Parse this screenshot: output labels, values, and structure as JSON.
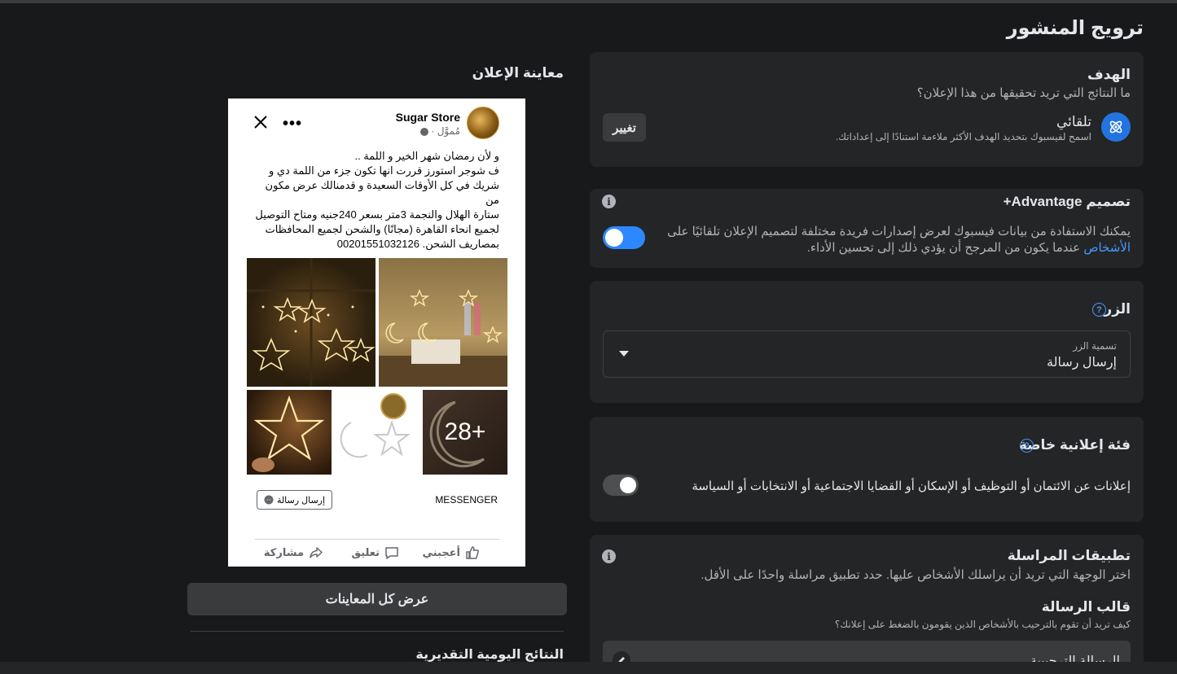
{
  "page": {
    "title": "ترويج المنشور"
  },
  "goal": {
    "heading": "الهدف",
    "question": "ما النتائج التي تريد تحقيقها من هذا الإعلان؟",
    "option_name": "تلقائي",
    "option_desc": "اسمح لفيسبوك بتحديد الهدف الأكثر ملاءمة استنادًا إلى إعداداتك.",
    "change_label": "تغيير"
  },
  "advantage": {
    "heading": "تصميم Advantage+",
    "desc_before": "يمكنك الاستفادة من بيانات فيسبوك لعرض إصدارات فريدة مختلفة لتصميم الإعلان تلقائيًا على ",
    "desc_link": "الأشخاص",
    "desc_after": " عندما يكون من المرجح أن يؤدي ذلك إلى تحسين الأداء.",
    "toggle_on": true
  },
  "button_section": {
    "heading": "الزر",
    "field_label": "تسمية الزر",
    "field_value": "إرسال رسالة"
  },
  "special_category": {
    "heading": "فئة إعلانية خاصة",
    "text": "إعلانات عن الائتمان أو التوظيف أو الإسكان أو القضايا الاجتماعية أو الانتخابات أو السياسة",
    "toggle_on": false
  },
  "messaging": {
    "heading": "تطبيقات المراسلة",
    "desc": "اختر الوجهة التي تريد أن يراسلك الأشخاص عليها. حدد تطبيق مراسلة واحدًا على الأقل.",
    "template_heading": "قالب الرسالة",
    "template_desc": "كيف تريد أن تقوم بالترحيب بالأشخاص الذين يقومون بالضغط على إعلانك؟",
    "template_row": "الرسالة الترحيبية"
  },
  "preview": {
    "title": "معاينة الإعلان",
    "page_name": "Sugar Store",
    "sponsored": "مُموَّل · ",
    "post_text": "و لأن رمضان شهر الخير و اللمة ..\nف شوجر استورز قررت انها تكون جزء من اللمة دي و شريك في كل الأوقات السعيدة و قدمنالك عرض مكون من\nستارة الهلال والنجمة 3متر بسعر 240جنيه ومتاح التوصيل لجميع انحاء القاهرة (مجانًا) والشحن لجميع المحافظات بمصاريف الشحن. 00201551032126",
    "more_count": "+28",
    "cta_source": "MESSENGER",
    "cta_button": "إرسال رسالة",
    "like": "أعجبني",
    "comment": "تعليق",
    "share": "مشاركة",
    "view_all": "عرض كل المعاينات",
    "daily_results": "النتائج اليومية التقديرية"
  },
  "colors": {
    "background": "#18191a",
    "card": "#242526",
    "accent": "#2d88ff",
    "link": "#4599ff"
  }
}
